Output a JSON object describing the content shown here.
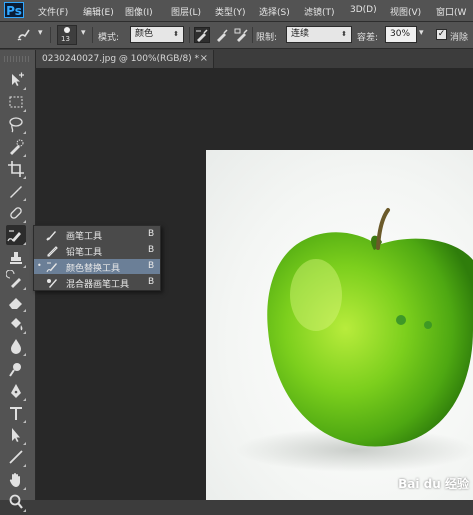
{
  "app": {
    "logo": "Ps"
  },
  "menu": {
    "items": [
      {
        "label": "文件(F)"
      },
      {
        "label": "编辑(E)"
      },
      {
        "label": "图像(I)"
      },
      {
        "label": "图层(L)"
      },
      {
        "label": "类型(Y)"
      },
      {
        "label": "选择(S)"
      },
      {
        "label": "滤镜(T)"
      },
      {
        "label": "3D(D)"
      },
      {
        "label": "视图(V)"
      },
      {
        "label": "窗口(W"
      }
    ]
  },
  "options": {
    "brush_size": "13",
    "mode_label": "模式:",
    "mode_value": "颜色",
    "limit_label": "限制:",
    "limit_value": "连续",
    "tolerance_label": "容差:",
    "tolerance_value": "30%",
    "antialias_label": "消除",
    "antialias_checked": "✓"
  },
  "document": {
    "tab_label": "0230240027.jpg @ 100%(RGB/8) *",
    "close": "×"
  },
  "flyout": {
    "items": [
      {
        "label": "画笔工具",
        "shortcut": "B",
        "selected": false,
        "bullet": ""
      },
      {
        "label": "铅笔工具",
        "shortcut": "B",
        "selected": false,
        "bullet": ""
      },
      {
        "label": "颜色替换工具",
        "shortcut": "B",
        "selected": true,
        "bullet": "•"
      },
      {
        "label": "混合器画笔工具",
        "shortcut": "B",
        "selected": false,
        "bullet": ""
      }
    ]
  },
  "tools": [
    "move-tool-icon",
    "marquee-tool-icon",
    "lasso-tool-icon",
    "quick-selection-tool-icon",
    "crop-tool-icon",
    "eyedropper-tool-icon",
    "healing-brush-tool-icon",
    "color-replacement-tool-icon",
    "clone-stamp-tool-icon",
    "history-brush-tool-icon",
    "eraser-tool-icon",
    "paint-bucket-tool-icon",
    "blur-tool-icon",
    "dodge-tool-icon",
    "pen-tool-icon",
    "type-tool-icon",
    "path-selection-tool-icon",
    "line-tool-icon",
    "hand-tool-icon",
    "zoom-tool-icon"
  ],
  "watermark": "Bai du 经验",
  "colors": {
    "panel": "#535353",
    "canvas": "#282828",
    "selection": "#6b7f97",
    "accent": "#31a8ff"
  }
}
